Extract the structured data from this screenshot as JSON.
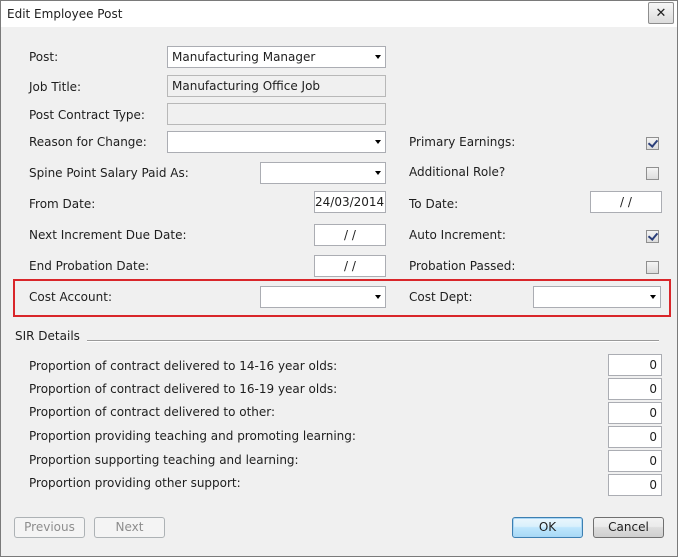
{
  "window": {
    "title": "Edit Employee Post",
    "close_glyph": "✕"
  },
  "post": {
    "label": "Post:",
    "value": "Manufacturing Manager"
  },
  "job_title": {
    "label": "Job Title:",
    "value": "Manufacturing Office Job"
  },
  "post_contract_type": {
    "label": "Post Contract Type:",
    "value": ""
  },
  "reason_for_change": {
    "label": "Reason for Change:",
    "value": ""
  },
  "spine_point": {
    "label": "Spine Point Salary Paid As:",
    "value": ""
  },
  "from_date": {
    "label": "From Date:",
    "value": "24/03/2014"
  },
  "next_increment": {
    "label": "Next Increment Due Date:",
    "value": " /  /"
  },
  "end_probation": {
    "label": "End Probation Date:",
    "value": " /  /"
  },
  "primary_earnings": {
    "label": "Primary Earnings:",
    "checked": true
  },
  "additional_role": {
    "label": "Additional Role?",
    "checked": false
  },
  "to_date": {
    "label": "To Date:",
    "value": " /  /"
  },
  "auto_increment": {
    "label": "Auto Increment:",
    "checked": true
  },
  "probation_passed": {
    "label": "Probation Passed:",
    "checked": false
  },
  "cost_account": {
    "label": "Cost Account:",
    "value": ""
  },
  "cost_dept": {
    "label": "Cost Dept:",
    "value": ""
  },
  "sir": {
    "heading": "SIR Details",
    "rows": [
      {
        "label": "Proportion of contract delivered to 14-16 year olds:",
        "value": "0"
      },
      {
        "label": "Proportion of contract delivered to 16-19 year olds:",
        "value": "0"
      },
      {
        "label": "Proportion of contract delivered to other:",
        "value": "0"
      },
      {
        "label": "Proportion providing teaching  and promoting learning:",
        "value": "0"
      },
      {
        "label": "Proportion supporting teaching and learning:",
        "value": "0"
      },
      {
        "label": "Proportion providing other support:",
        "value": "0"
      }
    ]
  },
  "buttons": {
    "previous": "Previous",
    "next": "Next",
    "ok": "OK",
    "cancel": "Cancel"
  }
}
